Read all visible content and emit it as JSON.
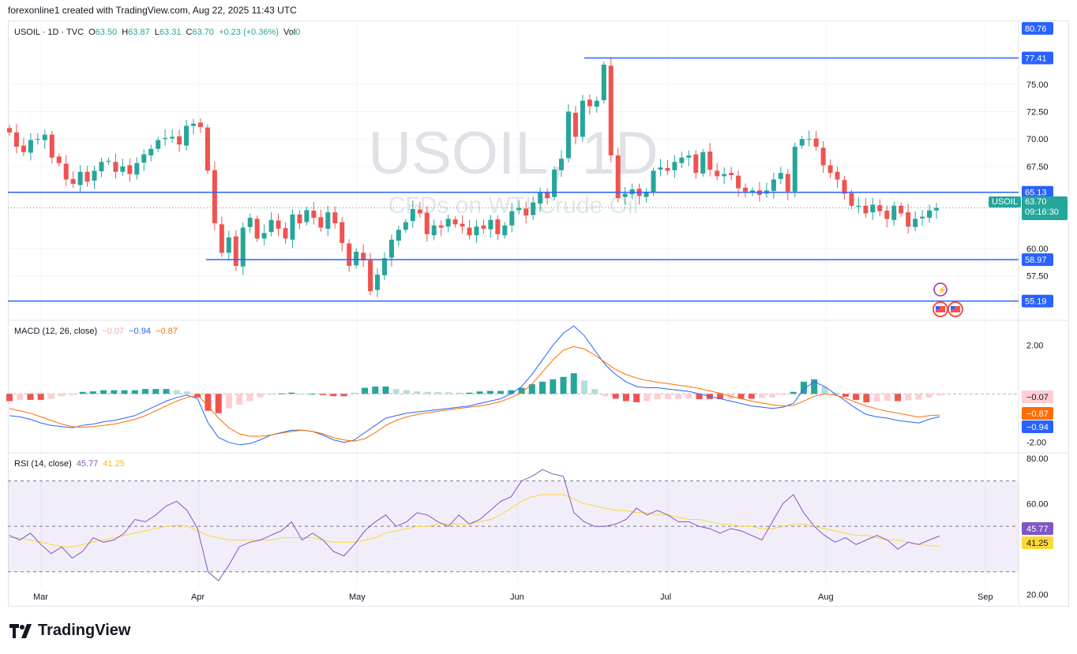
{
  "header": {
    "text": "forexonline1 created with TradingView.com, Aug 22, 2025 11:43 UTC"
  },
  "legend": {
    "symbol": "USOIL · 1D · TVC",
    "o_label": "O",
    "o": "63.50",
    "h_label": "H",
    "h": "63.87",
    "l_label": "L",
    "l": "63.31",
    "c_label": "C",
    "c": "63.70",
    "change": "+0.23 (+0.36%)",
    "vol_label": "Vol",
    "vol": "0"
  },
  "watermark": {
    "title": "USOIL, 1D",
    "subtitle": "CFDs on WTI Crude Oil"
  },
  "macd_legend": {
    "label": "MACD (12, 26, close)",
    "hist": "−0.07",
    "macd": "−0.94",
    "signal": "−0.87"
  },
  "rsi_legend": {
    "label": "RSI (14, close)",
    "rsi": "45.77",
    "ma": "41.25"
  },
  "symbol_tag": "USOIL",
  "current_price": "63.70",
  "countdown": "09:16:30",
  "brand": {
    "name": "TradingView"
  },
  "colors": {
    "up": "#26a69a",
    "down": "#ef5350",
    "level": "#2962ff",
    "macd": "#2962ff",
    "signal": "#ff6d00",
    "rsi": "#7e57c2",
    "rsi_ma": "#fdd835"
  },
  "chart_data": [
    {
      "type": "candlestick",
      "ylim": [
        53.5,
        80.76
      ],
      "y_ticks": [
        57.5,
        60.0,
        67.5,
        70.0,
        72.5,
        75.0
      ],
      "y_tick_labels": [
        "57.50",
        "60.00",
        "67.50",
        "70.00",
        "72.50",
        "75.00"
      ],
      "x_tick_labels": [
        "Mar",
        "Apr",
        "May",
        "Jun",
        "Jul",
        "Aug",
        "Sep"
      ],
      "axis_top_label": "80.76",
      "levels": [
        {
          "value": 77.41,
          "label": "77.41"
        },
        {
          "value": 65.13,
          "label": "65.13"
        },
        {
          "value": 58.97,
          "label": "58.97"
        },
        {
          "value": 55.19,
          "label": "55.19"
        }
      ],
      "closes": [
        70.6,
        69.3,
        68.8,
        69.9,
        70.0,
        70.4,
        68.3,
        67.8,
        66.3,
        65.9,
        67.0,
        66.1,
        67.1,
        67.9,
        68.0,
        67.0,
        67.5,
        66.8,
        67.8,
        68.6,
        69.1,
        69.9,
        70.1,
        70.2,
        69.5,
        71.2,
        71.4,
        71.1,
        67.1,
        62.3,
        59.6,
        61.0,
        58.4,
        61.9,
        62.8,
        60.9,
        61.4,
        62.6,
        61.8,
        60.9,
        63.1,
        62.3,
        63.5,
        62.8,
        61.9,
        63.3,
        62.3,
        60.5,
        58.4,
        59.7,
        58.9,
        56.1,
        57.6,
        59.1,
        60.8,
        61.7,
        62.4,
        63.6,
        63.2,
        61.3,
        62.1,
        61.9,
        62.7,
        62.2,
        62.0,
        61.2,
        62.0,
        61.8,
        62.6,
        61.3,
        62.1,
        63.4,
        63.7,
        63.0,
        64.2,
        65.1,
        64.6,
        67.2,
        68.2,
        72.5,
        70.2,
        73.5,
        73.0,
        73.5,
        76.8,
        68.5,
        64.6,
        65.0,
        65.4,
        64.8,
        65.1,
        67.1,
        67.4,
        67.1,
        67.9,
        68.3,
        68.5,
        66.9,
        68.8,
        67.2,
        66.6,
        66.8,
        66.7,
        65.5,
        65.2,
        65.3,
        64.9,
        65.3,
        66.3,
        66.9,
        65.2,
        69.3,
        70.0,
        70.0,
        69.3,
        67.6,
        66.9,
        66.3,
        65.0,
        63.9,
        63.9,
        63.2,
        64.0,
        63.4,
        62.7,
        63.9,
        63.2,
        62.0,
        62.7,
        62.9,
        63.47,
        63.7
      ]
    },
    {
      "type": "macd",
      "ylim": [
        -2.4,
        3.0
      ],
      "y_tick_labels": [
        "2.00",
        "-2.00"
      ],
      "macd": [
        -0.9,
        -0.95,
        -1.05,
        -1.2,
        -1.3,
        -1.35,
        -1.4,
        -1.3,
        -1.25,
        -1.15,
        -1.1,
        -1.0,
        -0.9,
        -0.7,
        -0.5,
        -0.3,
        -0.15,
        -0.05,
        -0.2,
        -1.2,
        -1.8,
        -2.0,
        -2.1,
        -2.05,
        -1.9,
        -1.7,
        -1.6,
        -1.5,
        -1.5,
        -1.55,
        -1.7,
        -1.9,
        -2.0,
        -1.9,
        -1.6,
        -1.3,
        -1.0,
        -0.9,
        -0.8,
        -0.75,
        -0.7,
        -0.65,
        -0.6,
        -0.55,
        -0.5,
        -0.4,
        -0.3,
        -0.2,
        0.0,
        0.3,
        0.8,
        1.4,
        2.0,
        2.5,
        2.8,
        2.4,
        1.8,
        1.2,
        0.8,
        0.5,
        0.3,
        0.25,
        0.25,
        0.2,
        0.15,
        0.1,
        0.0,
        -0.1,
        -0.2,
        -0.3,
        -0.4,
        -0.5,
        -0.55,
        -0.6,
        -0.55,
        -0.4,
        0.2,
        0.5,
        0.3,
        0.0,
        -0.3,
        -0.6,
        -0.85,
        -0.95,
        -1.0,
        -1.1,
        -1.15,
        -1.2,
        -1.05,
        -0.94
      ],
      "signal": [
        -0.6,
        -0.7,
        -0.8,
        -0.95,
        -1.1,
        -1.25,
        -1.35,
        -1.38,
        -1.35,
        -1.3,
        -1.25,
        -1.15,
        -1.05,
        -0.9,
        -0.7,
        -0.5,
        -0.3,
        -0.15,
        -0.05,
        -0.5,
        -1.0,
        -1.4,
        -1.65,
        -1.75,
        -1.75,
        -1.7,
        -1.62,
        -1.55,
        -1.5,
        -1.55,
        -1.65,
        -1.8,
        -1.9,
        -1.95,
        -1.85,
        -1.6,
        -1.3,
        -1.1,
        -0.95,
        -0.85,
        -0.78,
        -0.72,
        -0.66,
        -0.6,
        -0.55,
        -0.5,
        -0.42,
        -0.32,
        -0.15,
        0.05,
        0.4,
        0.9,
        1.4,
        1.8,
        1.95,
        1.85,
        1.6,
        1.3,
        1.0,
        0.8,
        0.65,
        0.55,
        0.48,
        0.42,
        0.36,
        0.3,
        0.22,
        0.12,
        0.02,
        -0.1,
        -0.2,
        -0.3,
        -0.38,
        -0.45,
        -0.5,
        -0.48,
        -0.3,
        -0.1,
        0.0,
        -0.05,
        -0.18,
        -0.35,
        -0.5,
        -0.62,
        -0.72,
        -0.8,
        -0.88,
        -0.96,
        -0.9,
        -0.87
      ],
      "histogram": [
        -0.3,
        -0.25,
        -0.25,
        -0.25,
        -0.2,
        -0.1,
        -0.05,
        0.08,
        0.1,
        0.15,
        0.15,
        0.15,
        0.15,
        0.2,
        0.2,
        0.2,
        0.15,
        0.1,
        -0.15,
        -0.7,
        -0.8,
        -0.6,
        -0.45,
        -0.3,
        -0.15,
        0.0,
        0.02,
        0.05,
        0.0,
        0.0,
        -0.05,
        -0.1,
        -0.1,
        0.05,
        0.25,
        0.3,
        0.3,
        0.2,
        0.15,
        0.1,
        0.08,
        0.07,
        0.06,
        0.05,
        0.05,
        0.1,
        0.12,
        0.12,
        0.15,
        0.25,
        0.4,
        0.5,
        0.6,
        0.7,
        0.85,
        0.55,
        0.2,
        -0.1,
        -0.2,
        -0.3,
        -0.35,
        -0.3,
        -0.23,
        -0.22,
        -0.21,
        -0.2,
        -0.22,
        -0.22,
        -0.22,
        -0.2,
        -0.2,
        -0.2,
        -0.17,
        -0.15,
        -0.05,
        0.08,
        0.5,
        0.6,
        0.3,
        0.05,
        -0.12,
        -0.25,
        -0.35,
        -0.33,
        -0.28,
        -0.3,
        -0.27,
        -0.24,
        -0.15,
        -0.07
      ]
    },
    {
      "type": "rsi",
      "ylim": [
        15,
        82
      ],
      "bands": [
        30,
        50,
        70
      ],
      "y_tick_labels": [
        "80.00",
        "60.00",
        "20.00"
      ],
      "rsi": [
        46,
        44,
        47,
        42,
        38,
        41,
        36,
        39,
        45,
        43,
        44,
        47,
        53,
        52,
        55,
        59,
        61,
        57,
        49,
        30,
        26,
        33,
        41,
        43,
        44,
        46,
        48,
        52,
        44,
        47,
        44,
        39,
        37,
        42,
        48,
        52,
        55,
        50,
        52,
        56,
        55,
        52,
        50,
        55,
        51,
        53,
        57,
        61,
        63,
        70,
        72,
        75,
        73,
        72,
        56,
        52,
        50,
        50,
        51,
        53,
        58,
        55,
        57,
        55,
        52,
        52,
        50,
        49,
        47,
        49,
        48,
        46,
        44,
        52,
        60,
        64,
        56,
        50,
        46,
        43,
        45,
        42,
        44,
        46,
        44,
        40,
        43,
        42,
        44,
        45.77
      ],
      "rsi_ma": [
        45,
        45,
        44,
        43,
        42,
        41,
        41,
        42,
        43,
        44,
        45,
        46,
        47,
        48,
        49,
        50,
        50.5,
        50,
        48,
        46,
        45,
        44,
        44,
        44,
        44,
        44,
        45,
        45,
        45,
        45,
        44,
        43,
        43,
        43,
        44,
        45,
        47,
        48,
        49,
        50,
        50,
        51,
        51,
        51,
        51,
        52,
        53,
        55,
        58,
        61,
        63,
        64,
        64,
        64,
        62,
        60,
        59,
        58,
        57,
        57,
        56,
        56,
        55,
        55,
        54,
        53,
        53,
        52,
        51,
        51,
        50,
        50,
        49,
        49,
        50,
        51,
        51,
        50,
        49,
        48,
        47,
        46,
        46,
        45,
        44,
        44,
        43,
        42,
        41.5,
        41.25
      ]
    }
  ]
}
